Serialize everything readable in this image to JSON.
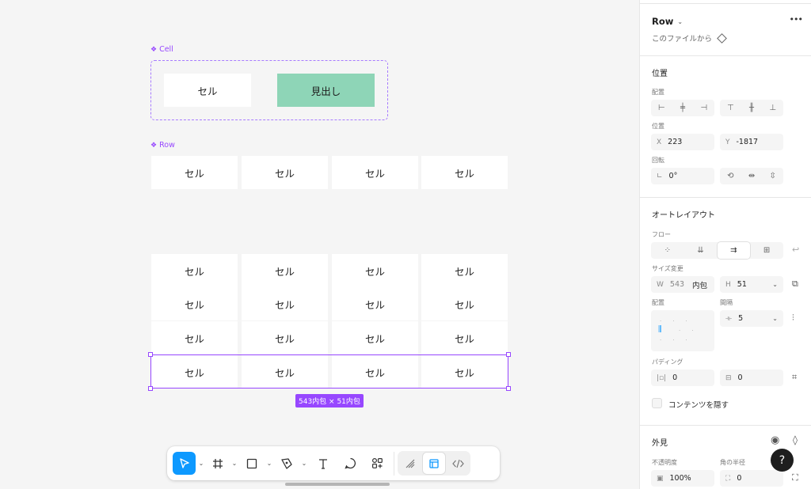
{
  "canvas": {
    "cell_component": {
      "label": "Cell",
      "cell_text": "セル",
      "heading_text": "見出し"
    },
    "row_component": {
      "label": "Row"
    },
    "row_cells": [
      "セル",
      "セル",
      "セル",
      "セル"
    ],
    "table_rows": [
      [
        "セル",
        "セル",
        "セル",
        "セル"
      ],
      [
        "セル",
        "セル",
        "セル",
        "セル"
      ],
      [
        "セル",
        "セル",
        "セル",
        "セル"
      ],
      [
        "セル",
        "セル",
        "セル",
        "セル"
      ]
    ],
    "selection_badge": "543内包 × 51内包"
  },
  "toolbar": {
    "tools": [
      "move-icon",
      "frame-icon",
      "rectangle-icon",
      "pen-icon",
      "text-icon",
      "comment-icon",
      "actions-icon"
    ],
    "modes": [
      "draw-mode-icon",
      "design-mode-icon",
      "dev-mode-icon"
    ]
  },
  "panel": {
    "title": "Row",
    "more": "•••",
    "subtitle": "このファイルから",
    "position": {
      "title": "位置",
      "align_label": "配置",
      "pos_label": "位置",
      "x_label": "X",
      "x": "223",
      "y_label": "Y",
      "y": "-1817",
      "rotation_label": "回転",
      "rotation": "0°"
    },
    "autolayout": {
      "title": "オートレイアウト",
      "flow_label": "フロー",
      "size_label": "サイズ変更",
      "w_label": "W",
      "w": "543",
      "w_mode": "内包",
      "h_label": "H",
      "h": "51",
      "align_label": "配置",
      "gap_label": "間隔",
      "gap": "5",
      "padding_label": "パディング",
      "pad_h": "0",
      "pad_v": "0",
      "clip_label": "コンテンツを隠す"
    },
    "appearance": {
      "title": "外見",
      "opacity_label": "不透明度",
      "opacity": "100%",
      "radius_label": "角の半径",
      "radius": "0"
    },
    "help": "?"
  },
  "colors": {
    "accent": "#9747ff",
    "blue": "#0d99ff",
    "green_cell": "#8ed5b7"
  }
}
